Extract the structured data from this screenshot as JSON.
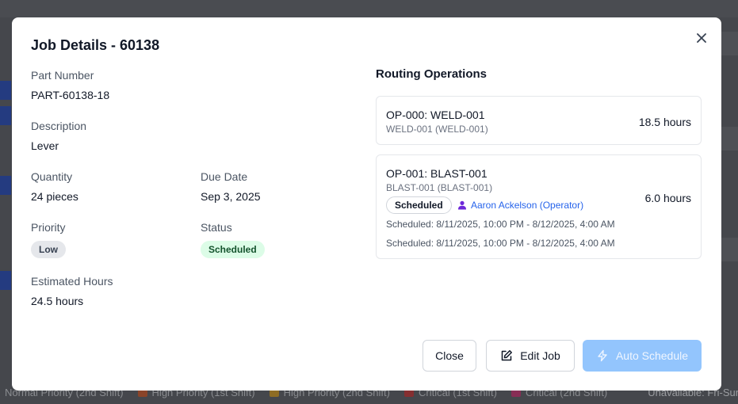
{
  "modal": {
    "title": "Job Details - 60138",
    "close_icon": "close-icon"
  },
  "job": {
    "part_number_label": "Part Number",
    "part_number": "PART-60138-18",
    "description_label": "Description",
    "description": "Lever",
    "quantity_label": "Quantity",
    "quantity": "24 pieces",
    "due_date_label": "Due Date",
    "due_date": "Sep 3, 2025",
    "priority_label": "Priority",
    "priority": "Low",
    "status_label": "Status",
    "status": "Scheduled",
    "estimated_hours_label": "Estimated Hours",
    "estimated_hours": "24.5 hours"
  },
  "routing": {
    "title": "Routing Operations",
    "operations": [
      {
        "title": "OP-000: WELD-001",
        "subtitle": "WELD-001 (WELD-001)",
        "hours": "18.5 hours"
      },
      {
        "title": "OP-001: BLAST-001",
        "subtitle": "BLAST-001 (BLAST-001)",
        "hours": "6.0 hours",
        "status": "Scheduled",
        "operator": "Aaron Ackelson (Operator)",
        "operator_icon": "user-icon",
        "schedule_lines": [
          "Scheduled: 8/11/2025, 10:00 PM - 8/12/2025, 4:00 AM",
          "Scheduled: 8/11/2025, 10:00 PM - 8/12/2025, 4:00 AM"
        ]
      }
    ]
  },
  "footer": {
    "close_label": "Close",
    "edit_label": "Edit Job",
    "edit_icon": "edit-icon",
    "auto_schedule_label": "Auto Schedule",
    "auto_schedule_icon": "lightning-icon"
  },
  "background_legend": {
    "items": [
      {
        "label": "Normal Priority (2nd Shift)",
        "color": "#1d4ed8"
      },
      {
        "label": "High Priority (1st Shift)",
        "color": "#c2410c"
      },
      {
        "label": "High Priority (2nd Shift)",
        "color": "#ca8a04"
      },
      {
        "label": "Critical (1st Shift)",
        "color": "#b91c1c"
      },
      {
        "label": "Critical (2nd Shift)",
        "color": "#be185d"
      }
    ],
    "available_label": "Unavailable: Fri-Sun"
  },
  "colors": {
    "accent": "#2563eb",
    "status_scheduled_bg": "#dcfce7",
    "priority_low_bg": "#e5e7eb",
    "primary_disabled": "#93c5fd"
  }
}
